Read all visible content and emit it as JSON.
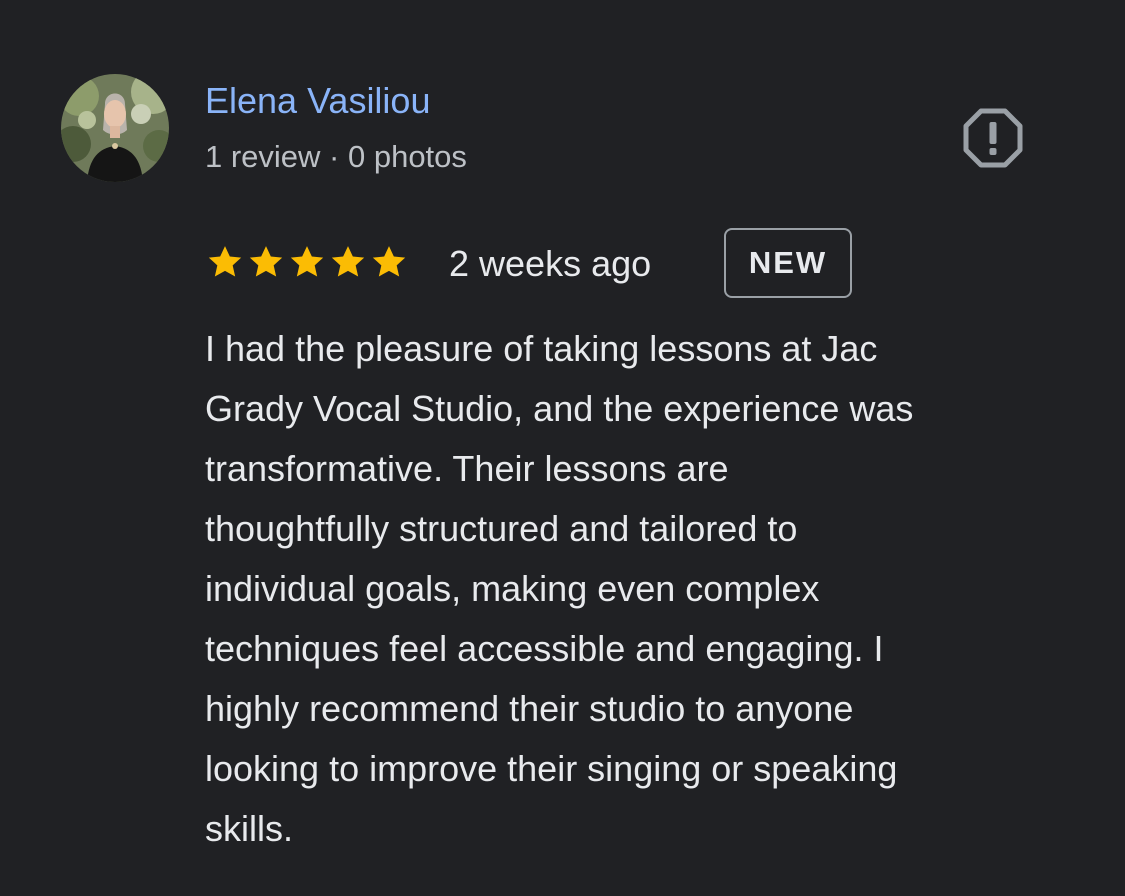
{
  "review": {
    "reviewer": {
      "name": "Elena Vasiliou",
      "meta": "1 review · 0 photos"
    },
    "rating": 5,
    "date": "2 weeks ago",
    "badge": "NEW",
    "text_lines": [
      "I had the pleasure of taking lessons at Jac",
      "Grady Vocal Studio, and the experience was",
      "transformative. Their lessons are",
      "thoughtfully structured and tailored to",
      "individual goals, making even complex",
      "techniques feel accessible and engaging. I",
      "highly recommend their studio to anyone",
      "looking to improve their singing or speaking",
      "skills."
    ]
  },
  "icons": {
    "report": "report-flag-icon",
    "star": "star-icon"
  },
  "colors": {
    "background": "#202124",
    "name_link": "#8ab4f8",
    "star": "#fbbc04",
    "text": "#e8eaed",
    "secondary_text": "#bdc1c6",
    "badge_border": "#9aa0a6"
  }
}
